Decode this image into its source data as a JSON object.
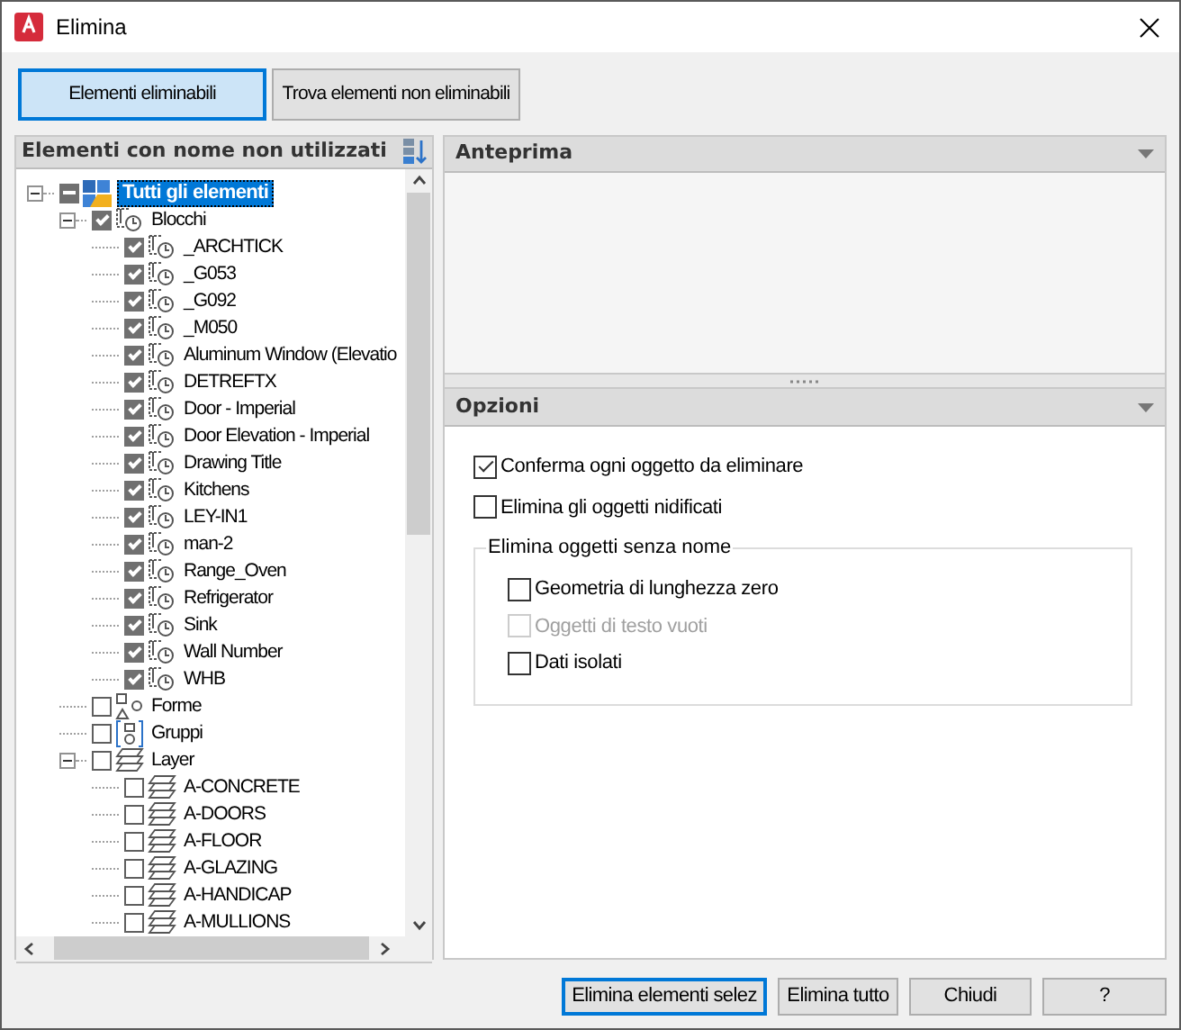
{
  "window": {
    "title": "Elimina"
  },
  "view_buttons": [
    {
      "label": "Elementi eliminabili",
      "selected": true
    },
    {
      "label": "Trova elementi non eliminabili",
      "selected": false
    }
  ],
  "tree_panel": {
    "title": "Elementi con nome non utilizzati",
    "items": [
      {
        "label": "Tutti gli elementi",
        "kind": "root",
        "checked": false,
        "partial": true,
        "selected": true,
        "expanded": true,
        "children": [
          {
            "label": "Blocchi",
            "kind": "block",
            "checked": true,
            "selected": false,
            "expanded": true,
            "children": [
              {
                "label": "_ARCHTICK",
                "kind": "block",
                "checked": true,
                "selected": false
              },
              {
                "label": "_G053",
                "kind": "block",
                "checked": true,
                "selected": false
              },
              {
                "label": "_G092",
                "kind": "block",
                "checked": true,
                "selected": false
              },
              {
                "label": "_M050",
                "kind": "block",
                "checked": true,
                "selected": false
              },
              {
                "label": "Aluminum Window (Elevatio",
                "kind": "block",
                "checked": true,
                "selected": false
              },
              {
                "label": "DETREFTX",
                "kind": "block",
                "checked": true,
                "selected": false
              },
              {
                "label": "Door - Imperial",
                "kind": "block",
                "checked": true,
                "selected": false
              },
              {
                "label": "Door Elevation - Imperial",
                "kind": "block",
                "checked": true,
                "selected": false
              },
              {
                "label": "Drawing Title",
                "kind": "block",
                "checked": true,
                "selected": false
              },
              {
                "label": "Kitchens",
                "kind": "block",
                "checked": true,
                "selected": false
              },
              {
                "label": "LEY-IN1",
                "kind": "block",
                "checked": true,
                "selected": false
              },
              {
                "label": "man-2",
                "kind": "block",
                "checked": true,
                "selected": false
              },
              {
                "label": "Range_Oven",
                "kind": "block",
                "checked": true,
                "selected": false
              },
              {
                "label": "Refrigerator",
                "kind": "block",
                "checked": true,
                "selected": false
              },
              {
                "label": "Sink",
                "kind": "block",
                "checked": true,
                "selected": false
              },
              {
                "label": "Wall Number",
                "kind": "block",
                "checked": true,
                "selected": false
              },
              {
                "label": "WHB",
                "kind": "block",
                "checked": true,
                "selected": false
              }
            ]
          },
          {
            "label": "Forme",
            "kind": "shapes",
            "checked": false,
            "selected": false
          },
          {
            "label": "Gruppi",
            "kind": "groups",
            "checked": false,
            "selected": false
          },
          {
            "label": "Layer",
            "kind": "layer",
            "checked": false,
            "selected": false,
            "expanded": true,
            "children": [
              {
                "label": "A-CONCRETE",
                "kind": "layer",
                "checked": false,
                "selected": false
              },
              {
                "label": "A-DOORS",
                "kind": "layer",
                "checked": false,
                "selected": false
              },
              {
                "label": "A-FLOOR",
                "kind": "layer",
                "checked": false,
                "selected": false
              },
              {
                "label": "A-GLAZING",
                "kind": "layer",
                "checked": false,
                "selected": false
              },
              {
                "label": "A-HANDICAP",
                "kind": "layer",
                "checked": false,
                "selected": false
              },
              {
                "label": "A-MULLIONS",
                "kind": "layer",
                "checked": false,
                "selected": false
              }
            ]
          }
        ]
      }
    ]
  },
  "preview_panel": {
    "title": "Anteprima"
  },
  "options_panel": {
    "title": "Opzioni",
    "options": [
      {
        "label": "Conferma ogni oggetto da eliminare",
        "checked": true,
        "disabled": false
      },
      {
        "label": "Elimina gli oggetti nidificati",
        "checked": false,
        "disabled": false
      }
    ],
    "unnamed_group": {
      "title": "Elimina oggetti senza nome",
      "options": [
        {
          "label": "Geometria di lunghezza zero",
          "checked": false,
          "disabled": false
        },
        {
          "label": "Oggetti di testo vuoti",
          "checked": false,
          "disabled": true
        },
        {
          "label": "Dati isolati",
          "checked": false,
          "disabled": false
        }
      ]
    }
  },
  "buttons": [
    {
      "label": "Elimina elementi selez",
      "default": true
    },
    {
      "label": "Elimina tutto",
      "default": false
    },
    {
      "label": "Chiudi",
      "default": false
    },
    {
      "label": "?",
      "default": false
    }
  ]
}
